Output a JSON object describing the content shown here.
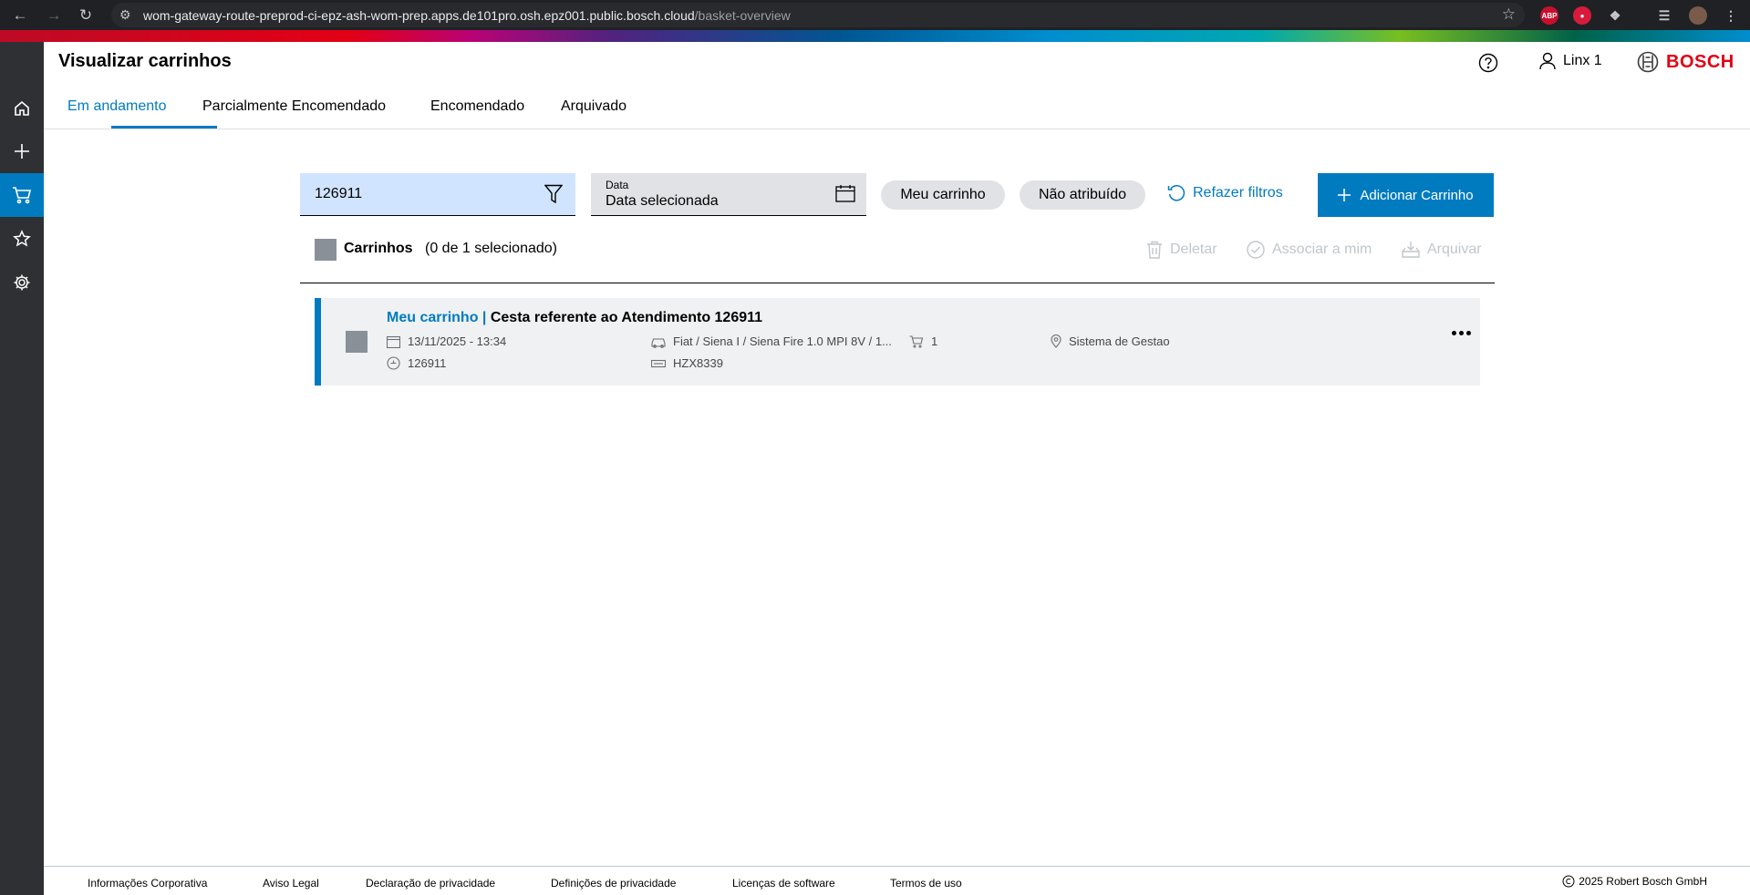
{
  "browser": {
    "url_host": "wom-gateway-route-preprod-ci-epz-ash-wom-prep.apps.de101pro.osh.epz001.public.bosch.cloud",
    "url_path": "/basket-overview"
  },
  "header": {
    "title": "Visualizar carrinhos",
    "user_name": "Linx 1",
    "brand": "BOSCH"
  },
  "tabs": [
    {
      "label": "Em andamento",
      "active": true
    },
    {
      "label": "Parcialmente Encomendado"
    },
    {
      "label": "Encomendado"
    },
    {
      "label": "Arquivado"
    }
  ],
  "filters": {
    "search_value": "126911",
    "date_label": "Data",
    "date_value": "Data selecionada",
    "chip_my_cart": "Meu carrinho",
    "chip_unassigned": "Não atribuído",
    "reset_label": "Refazer filtros",
    "add_button": "Adicionar Carrinho"
  },
  "list_header": {
    "title": "Carrinhos",
    "selection_count": "(0 de 1 selecionado)",
    "actions": {
      "delete": "Deletar",
      "assign": "Associar a mim",
      "archive": "Arquivar"
    }
  },
  "baskets": [
    {
      "owner": "Meu carrinho |",
      "title": "Cesta referente ao Atendimento 126911",
      "datetime": "13/11/2025 - 13:34",
      "order_no": "126911",
      "vehicle": "Fiat / Siena I / Siena Fire 1.0 MPI 8V / 1...",
      "plate": "HZX8339",
      "items": "1",
      "source": "Sistema de Gestao"
    }
  ],
  "footer": {
    "links": [
      "Informações Corporativa",
      "Aviso Legal",
      "Declaração de privacidade",
      "Definições de privacidade",
      "Licenças de software",
      "Termos de uso"
    ],
    "copyright": "2025 Robert Bosch GmbH"
  },
  "colors": {
    "accent": "#007bc0",
    "brand_red": "#e20015",
    "sidebar": "#2e3033"
  }
}
